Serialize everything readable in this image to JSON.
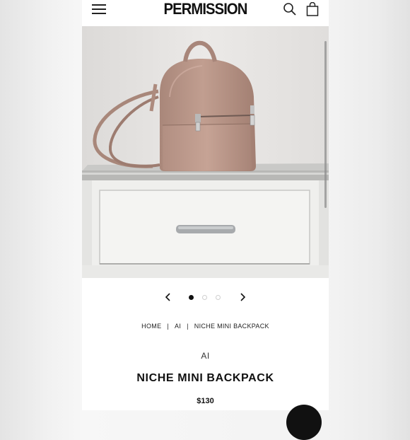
{
  "header": {
    "logo": "PERMISSION",
    "menu_icon": "hamburger-icon",
    "search_icon": "search-icon",
    "cart_icon": "shopping-bag-icon"
  },
  "product_image": {
    "subject": "backpack-on-drawer-photo",
    "colors": {
      "leather": "#b89587",
      "cabinet": "#efefed",
      "backdrop": "#e5e3e1"
    }
  },
  "carousel": {
    "prev_icon": "chevron-left-icon",
    "next_icon": "chevron-right-icon",
    "total_slides": 3,
    "active_slide": 1
  },
  "breadcrumb": {
    "items": [
      "HOME",
      "AI",
      "NICHE MINI BACKPACK"
    ],
    "separator": "|"
  },
  "product": {
    "brand": "AI",
    "title": "NICHE MINI BACKPACK",
    "price": "$130"
  },
  "chat": {
    "icon": "chat-bubble-icon"
  }
}
